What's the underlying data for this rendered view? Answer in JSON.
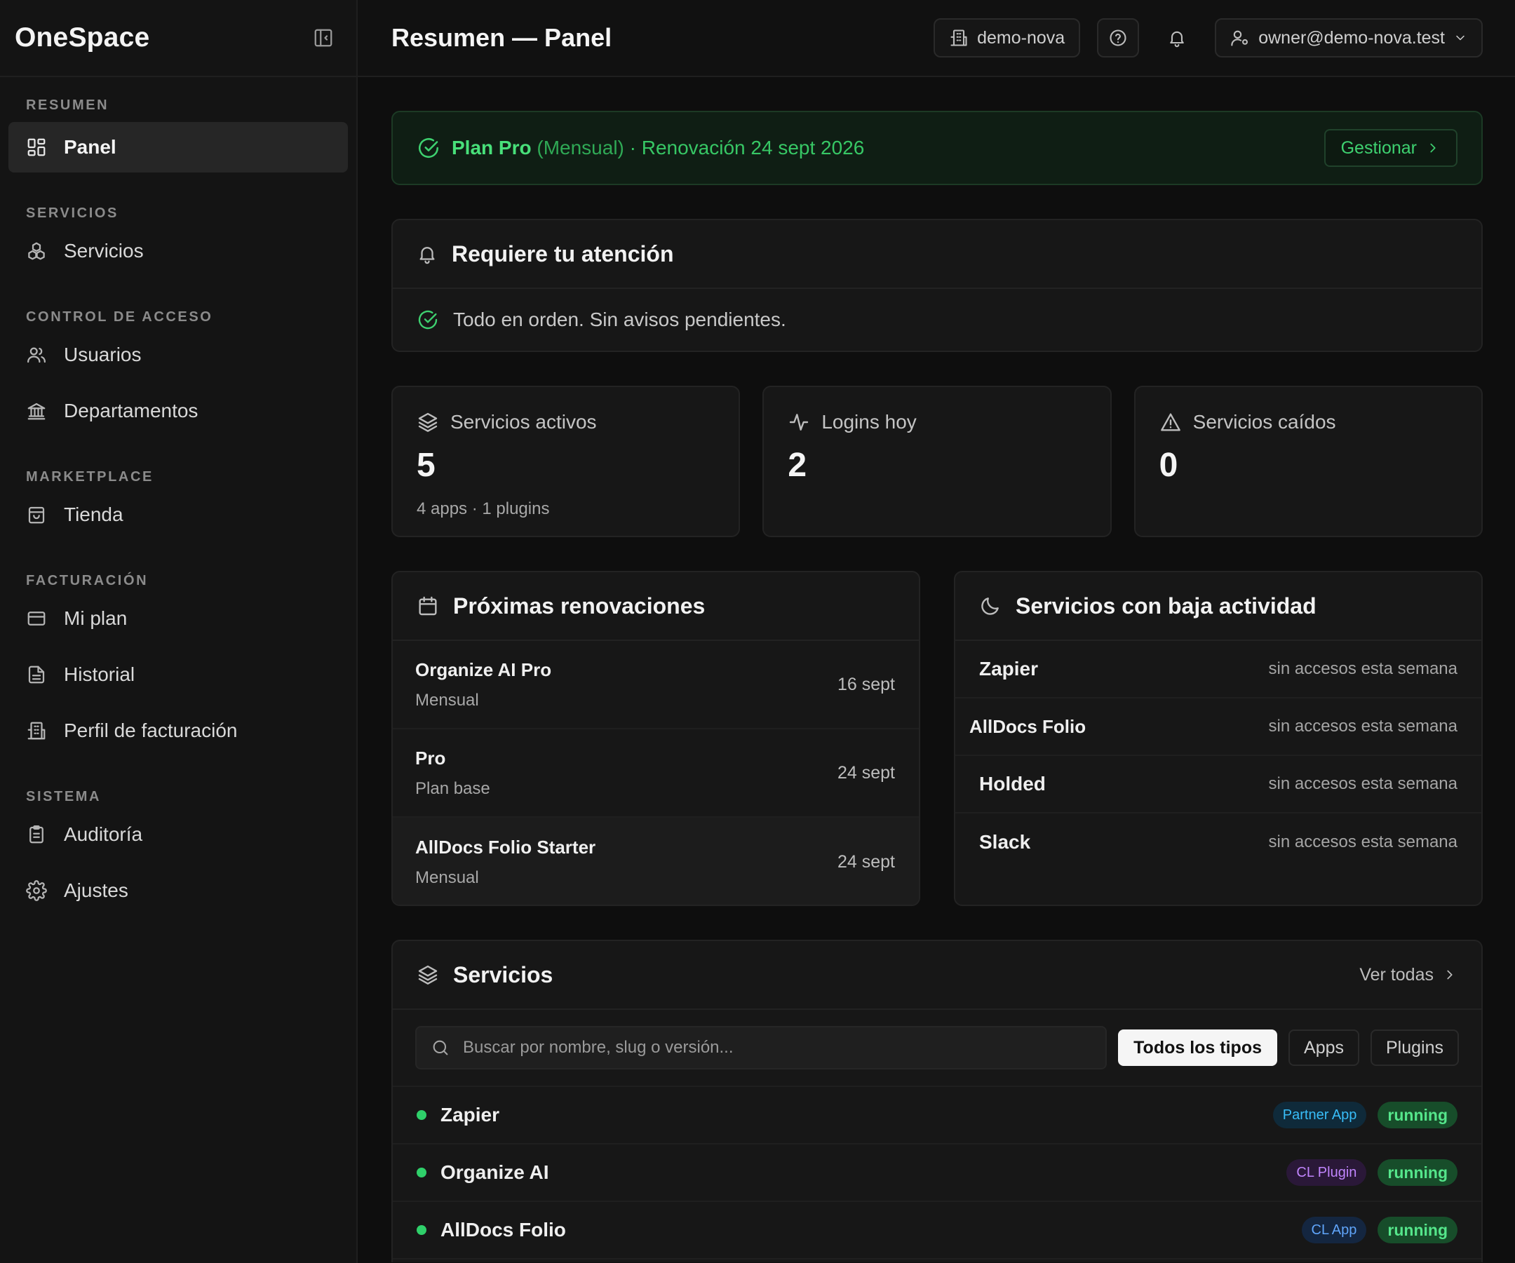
{
  "app": {
    "brand": "OneSpace"
  },
  "topbar": {
    "title": "Resumen — Panel",
    "workspace": "demo-nova",
    "user": "owner@demo-nova.test"
  },
  "sidebar": {
    "sections": [
      {
        "label": "RESUMEN",
        "items": [
          {
            "label": "Panel",
            "icon": "grid-icon",
            "active": true
          }
        ]
      },
      {
        "label": "SERVICIOS",
        "items": [
          {
            "label": "Servicios",
            "icon": "boxes-icon"
          }
        ]
      },
      {
        "label": "CONTROL DE ACCESO",
        "items": [
          {
            "label": "Usuarios",
            "icon": "users-icon"
          },
          {
            "label": "Departamentos",
            "icon": "landmark-icon"
          }
        ]
      },
      {
        "label": "MARKETPLACE",
        "items": [
          {
            "label": "Tienda",
            "icon": "store-icon"
          }
        ]
      },
      {
        "label": "FACTURACIÓN",
        "items": [
          {
            "label": "Mi plan",
            "icon": "credit-card-icon"
          },
          {
            "label": "Historial",
            "icon": "file-text-icon"
          },
          {
            "label": "Perfil de facturación",
            "icon": "building-icon"
          }
        ]
      },
      {
        "label": "SISTEMA",
        "items": [
          {
            "label": "Auditoría",
            "icon": "clipboard-icon"
          },
          {
            "label": "Ajustes",
            "icon": "gear-icon"
          }
        ]
      }
    ]
  },
  "plan": {
    "name": "Plan Pro",
    "period": "(Mensual)",
    "renewal": "· Renovación 24 sept 2026",
    "manage_label": "Gestionar",
    "color": "#3ed170"
  },
  "attention": {
    "title": "Requiere tu atención",
    "message": "Todo en orden. Sin avisos pendientes."
  },
  "stats": [
    {
      "label": "Servicios activos",
      "value": "5",
      "sub": "4 apps · 1 plugins",
      "icon": "layers-icon"
    },
    {
      "label": "Logins hoy",
      "value": "2",
      "sub": "",
      "icon": "activity-icon"
    },
    {
      "label": "Servicios caídos",
      "value": "0",
      "sub": "",
      "icon": "warning-icon"
    }
  ],
  "renewals": {
    "title": "Próximas renovaciones",
    "items": [
      {
        "name": "Organize AI Pro",
        "sub": "Mensual",
        "date": "16 sept"
      },
      {
        "name": "Pro",
        "sub": "Plan base",
        "date": "24 sept"
      },
      {
        "name": "AllDocs Folio Starter",
        "sub": "Mensual",
        "date": "24 sept"
      }
    ]
  },
  "low_activity": {
    "title": "Servicios con baja actividad",
    "items": [
      {
        "name": "Zapier",
        "note": "sin accesos esta semana"
      },
      {
        "name": "AllDocs Folio",
        "note": "sin accesos esta semana"
      },
      {
        "name": "Holded",
        "note": "sin accesos esta semana"
      },
      {
        "name": "Slack",
        "note": "sin accesos esta semana"
      }
    ]
  },
  "services": {
    "title": "Servicios",
    "see_all": "Ver todas",
    "search_placeholder": "Buscar por nombre, slug o versión...",
    "filters": [
      {
        "label": "Todos los tipos",
        "active": true
      },
      {
        "label": "Apps"
      },
      {
        "label": "Plugins"
      }
    ],
    "rows": [
      {
        "name": "Zapier",
        "type": "Partner App",
        "type_color": "#38bdf8",
        "type_bg": "#0f2a3a",
        "status": "running"
      },
      {
        "name": "Organize AI",
        "type": "CL Plugin",
        "type_color": "#c084fc",
        "type_bg": "#2a1838",
        "status": "running"
      },
      {
        "name": "AllDocs Folio",
        "type": "CL App",
        "type_color": "#60a5fa",
        "type_bg": "#142640",
        "status": "running"
      }
    ]
  }
}
